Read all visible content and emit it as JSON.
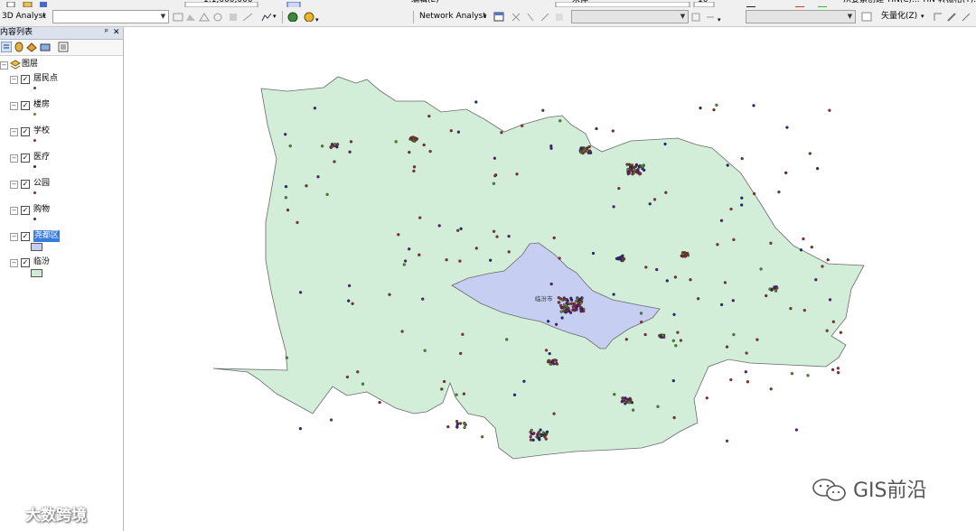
{
  "toolbar": {
    "analyst_3d_label": "3D Analyst",
    "scale_value": "1:1,000,000",
    "menu_partial": "编辑(E)",
    "font_value": "宋体",
    "font_size_value": "10",
    "network_analyst_label": "Network Analyst",
    "tin_label": "从要素创建 TIN(C)...",
    "tin_label2": "TIN 转栅格(T)...",
    "vectorize_label": "矢量化(Z)"
  },
  "toc": {
    "title": "内容列表",
    "pin": "ᵖ",
    "close": "✕",
    "root_label": "图层",
    "layers": [
      {
        "name": "居民点",
        "checked": true,
        "symbol": "point",
        "color": "#7a3b1c"
      },
      {
        "name": "楼房",
        "checked": true,
        "symbol": "point",
        "color": "#4a8a2a"
      },
      {
        "name": "学校",
        "checked": true,
        "symbol": "point",
        "color": "#9a2a4a"
      },
      {
        "name": "医疗",
        "checked": true,
        "symbol": "point",
        "color": "#1a2a8a"
      },
      {
        "name": "公园",
        "checked": true,
        "symbol": "point",
        "color": "#8a2a2a"
      },
      {
        "name": "购物",
        "checked": true,
        "symbol": "point",
        "color": "#5a1a7a"
      },
      {
        "name": "尧都区",
        "checked": true,
        "symbol": "polygon",
        "color": "#c5cff0",
        "selected": true
      },
      {
        "name": "临汾",
        "checked": true,
        "symbol": "polygon",
        "color": "#cfebd4"
      }
    ]
  },
  "map": {
    "city_label": "临汾市",
    "colors": {
      "linfen_fill": "#d2eed8",
      "yaodu_fill": "#c6cff2",
      "outline": "#6a6a6a"
    }
  },
  "watermarks": {
    "left": "大数跨境",
    "right": "GIS前沿"
  }
}
